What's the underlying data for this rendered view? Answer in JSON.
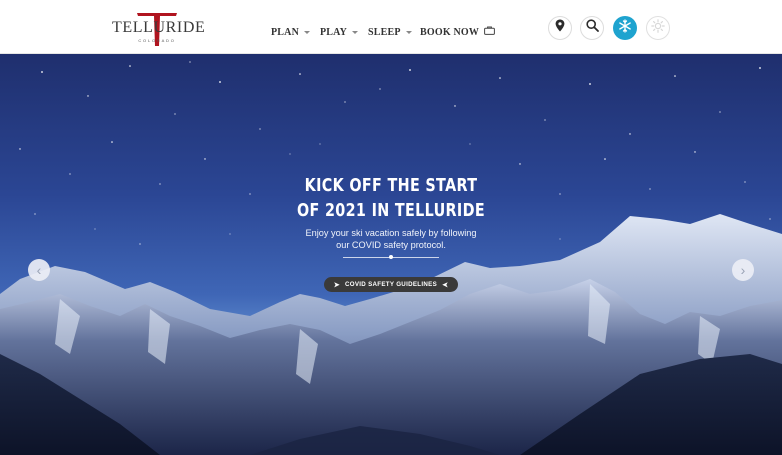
{
  "brand": {
    "name": "TELLURIDE",
    "sub": "COLORADO",
    "accent_color": "#b0141f"
  },
  "nav": {
    "items": [
      {
        "label": "PLAN",
        "has_dropdown": true
      },
      {
        "label": "PLAY",
        "has_dropdown": true
      },
      {
        "label": "SLEEP",
        "has_dropdown": true
      },
      {
        "label": "BOOK NOW",
        "icon": "briefcase-icon"
      }
    ]
  },
  "header_buttons": [
    {
      "name": "map-pin",
      "icon": "map-pin-icon"
    },
    {
      "name": "search",
      "icon": "search-icon"
    },
    {
      "name": "winter-season",
      "icon": "snowflake-icon",
      "active": true,
      "color": "#1ea3cf"
    },
    {
      "name": "summer-season",
      "icon": "sun-icon",
      "active": false
    }
  ],
  "hero": {
    "headline_line1": "KICK OFF THE START",
    "headline_line2": "OF 2021 IN TELLURIDE",
    "sub_line1": "Enjoy your ski vacation safely by following",
    "sub_line2": "our COVID safety protocol.",
    "cta_label": "COVID SAFETY GUIDELINES",
    "prev_arrow": "‹",
    "next_arrow": "›"
  }
}
